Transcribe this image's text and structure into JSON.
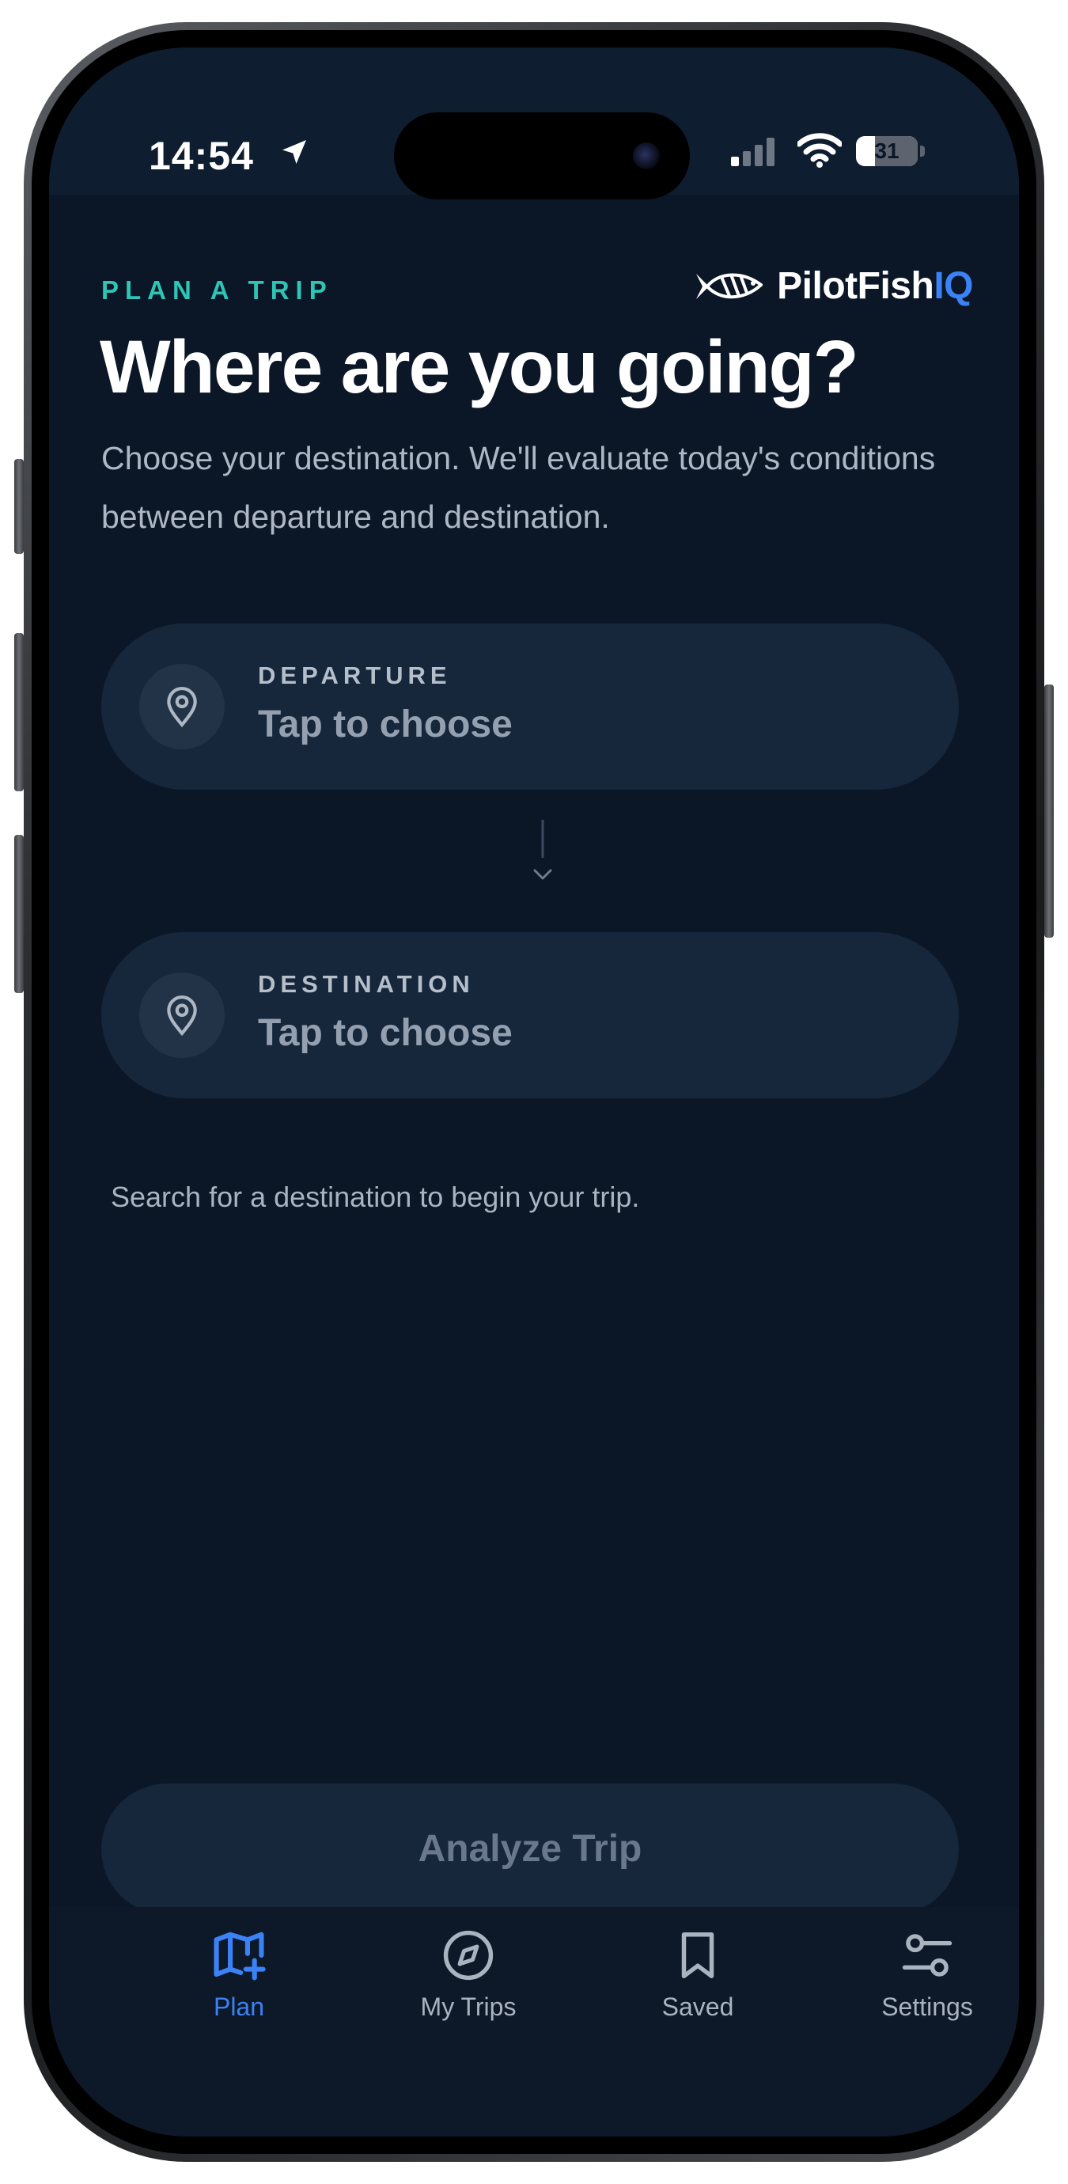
{
  "status_bar": {
    "time": "14:54",
    "battery": "31"
  },
  "header": {
    "eyebrow": "PLAN A TRIP",
    "brand_name": "PilotFish",
    "brand_accent": "IQ",
    "title": "Where are you going?",
    "subtitle": "Choose your destination. We'll evaluate today's conditions between departure and destination."
  },
  "departure": {
    "label": "DEPARTURE",
    "value": "Tap to choose"
  },
  "destination": {
    "label": "DESTINATION",
    "value": "Tap to choose"
  },
  "hint": "Search for a destination to begin your trip.",
  "analyze_button": "Analyze Trip",
  "tabs": [
    {
      "label": "Plan",
      "icon": "map-plus-icon",
      "active": true
    },
    {
      "label": "My Trips",
      "icon": "compass-icon",
      "active": false
    },
    {
      "label": "Saved",
      "icon": "bookmark-icon",
      "active": false
    },
    {
      "label": "Settings",
      "icon": "sliders-icon",
      "active": false
    }
  ],
  "colors": {
    "background": "#0b1727",
    "card": "#16263b",
    "accent_teal": "#2ec4b6",
    "accent_blue": "#3b82f6",
    "text_primary": "#ffffff",
    "text_muted": "#aab3c0"
  }
}
